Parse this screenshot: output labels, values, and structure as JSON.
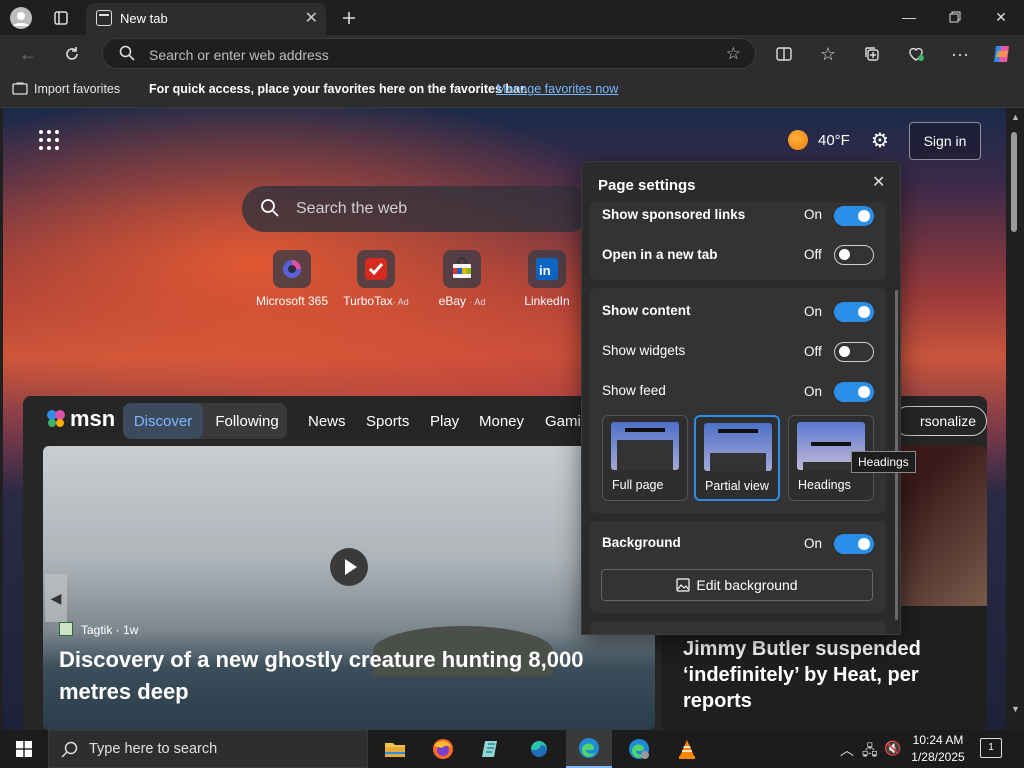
{
  "browser": {
    "tab_title": "New tab",
    "address_placeholder": "Search or enter web address"
  },
  "favorites_bar": {
    "import_label": "Import favorites",
    "message": "For quick access, place your favorites here on the favorites bar.",
    "manage_link": "Manage favorites now"
  },
  "ntp": {
    "weather_temp": "40°F",
    "sign_in": "Sign in",
    "search_placeholder": "Search the web",
    "tiles": [
      {
        "label": "Microsoft 365",
        "ad": ""
      },
      {
        "label": "TurboTax",
        "ad": "· Ad"
      },
      {
        "label": "eBay",
        "ad": "· Ad"
      },
      {
        "label": "LinkedIn",
        "ad": ""
      }
    ]
  },
  "feed": {
    "logo": "msn",
    "tabs": [
      "Discover",
      "Following"
    ],
    "nav": [
      "News",
      "Sports",
      "Play",
      "Money",
      "Gami"
    ],
    "personalize": "rsonalize",
    "main_card": {
      "source": "Tagtik · 1w",
      "headline": "Discovery of a new ghostly creature hunting 8,000 metres deep"
    },
    "side_card": {
      "headline": "Jimmy Butler suspended ‘indefinitely’ by Heat, per reports"
    }
  },
  "page_settings": {
    "title": "Page settings",
    "rows": [
      {
        "label": "Show sponsored links",
        "state": "On",
        "on": true
      },
      {
        "label": "Open in a new tab",
        "state": "Off",
        "on": false
      },
      {
        "label": "Show content",
        "state": "On",
        "on": true
      },
      {
        "label": "Show widgets",
        "state": "Off",
        "on": false
      },
      {
        "label": "Show feed",
        "state": "On",
        "on": true
      }
    ],
    "layouts": [
      "Full page",
      "Partial view",
      "Headings"
    ],
    "selected_layout": "Partial view",
    "background_label": "Background",
    "background_state": "On",
    "edit_background": "Edit background",
    "tooltip": "Headings"
  },
  "taskbar": {
    "search_placeholder": "Type here to search",
    "time": "10:24 AM",
    "date": "1/28/2025",
    "notification_count": "1"
  },
  "colors": {
    "accent": "#2b8ee8",
    "link": "#79b8ff"
  }
}
